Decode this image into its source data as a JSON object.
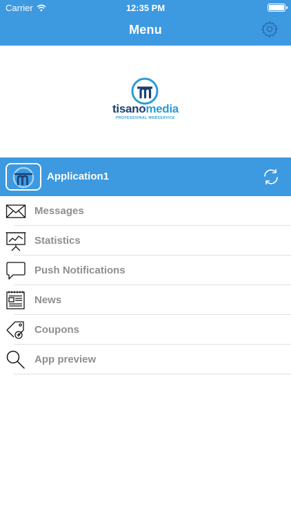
{
  "status_bar": {
    "carrier": "Carrier",
    "time": "12:35 PM"
  },
  "nav": {
    "title": "Menu",
    "settings_icon": "gear-icon"
  },
  "logo": {
    "wordmark_part1": "tisano",
    "wordmark_part2": "media",
    "tagline": "PROFESSIONAL WEBSERVICE"
  },
  "app": {
    "name": "Application1",
    "refresh_icon": "refresh-icon"
  },
  "menu": {
    "items": [
      {
        "label": "Messages",
        "icon": "envelope-icon"
      },
      {
        "label": "Statistics",
        "icon": "presentation-chart-icon"
      },
      {
        "label": "Push Notifications",
        "icon": "speech-bubble-icon"
      },
      {
        "label": "News",
        "icon": "newspaper-icon"
      },
      {
        "label": "Coupons",
        "icon": "tag-plus-icon"
      },
      {
        "label": "App preview",
        "icon": "magnifier-icon"
      }
    ]
  },
  "colors": {
    "primary": "#3d99e0",
    "menu_text": "#8f8f93",
    "divider": "#e1e1e1"
  }
}
